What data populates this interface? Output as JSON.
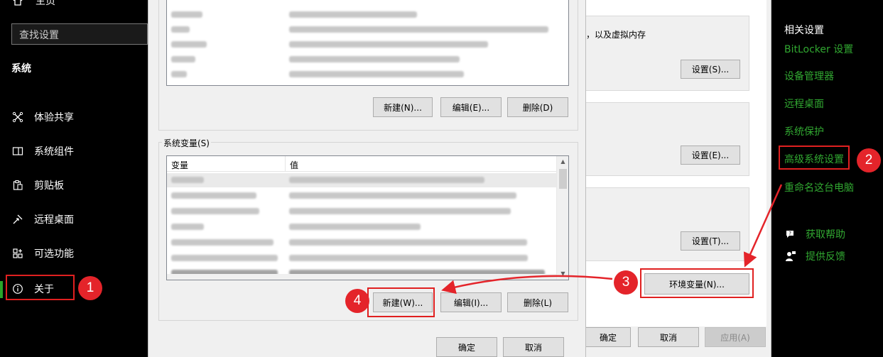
{
  "sidebar": {
    "home_label": "主页",
    "search_placeholder": "查找设置",
    "section_title": "系统",
    "items": [
      {
        "label": "体验共享",
        "icon": "share-icon"
      },
      {
        "label": "系统组件",
        "icon": "components-icon"
      },
      {
        "label": "剪贴板",
        "icon": "clipboard-icon"
      },
      {
        "label": "远程桌面",
        "icon": "remote-desktop-icon"
      },
      {
        "label": "可选功能",
        "icon": "optional-features-icon"
      },
      {
        "label": "关于",
        "icon": "info-icon"
      }
    ],
    "accent_color": "#2aa52a"
  },
  "env_dialog": {
    "user_vars_buttons": {
      "new": "新建(N)...",
      "edit": "编辑(E)...",
      "delete": "删除(D)"
    },
    "system_vars_label": "系统变量(S)",
    "columns": {
      "name": "变量",
      "value": "值"
    },
    "system_vars_buttons": {
      "new": "新建(W)...",
      "edit": "编辑(I)...",
      "delete": "删除(L)"
    },
    "ok": "确定",
    "cancel": "取消"
  },
  "sys_props": {
    "perf_desc_fragment": "，以及虚拟内存",
    "perf_settings": "设置(S)...",
    "profile_settings": "设置(E)...",
    "startup_settings": "设置(T)...",
    "env_vars_button": "环境变量(N)...",
    "ok": "确定",
    "cancel": "取消",
    "apply": "应用(A)"
  },
  "related": {
    "title": "相关设置",
    "links": [
      "BitLocker 设置",
      "设备管理器",
      "远程桌面",
      "系统保护",
      "高级系统设置",
      "重命名这台电脑"
    ],
    "get_help": "获取帮助",
    "feedback": "提供反馈",
    "link_color": "#31a831"
  },
  "annotations": {
    "steps": [
      "1",
      "2",
      "3",
      "4"
    ],
    "color": "#e4242a"
  }
}
